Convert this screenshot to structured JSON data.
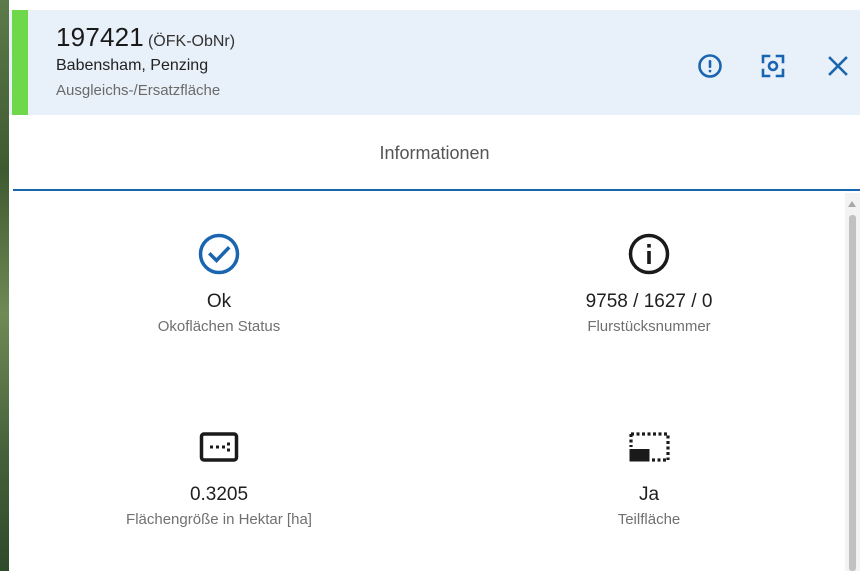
{
  "header": {
    "object_number": "197421",
    "object_suffix": "(ÖFK-ObNr)",
    "location": "Babensham, Penzing",
    "type": "Ausgleichs-/Ersatzfläche",
    "status_color": "#6fd84a",
    "accent_color": "#1a65b0",
    "buttons": [
      {
        "name": "report-button",
        "icon": "alert-circle-icon"
      },
      {
        "name": "focus-button",
        "icon": "center-focus-icon"
      },
      {
        "name": "close-button",
        "icon": "close-icon"
      }
    ]
  },
  "tabs": {
    "active": "Informationen"
  },
  "info": [
    {
      "value": "Ok",
      "label": "Okoflächen Status",
      "icon": "check-circle-icon"
    },
    {
      "value": "9758 / 1627 / 0",
      "label": "Flurstücksnummer",
      "icon": "info-icon"
    },
    {
      "value": "0.3205",
      "label": "Flächengröße in Hektar [ha]",
      "icon": "area-size-icon"
    },
    {
      "value": "Ja",
      "label": "Teilfläche",
      "icon": "partial-area-icon"
    }
  ]
}
